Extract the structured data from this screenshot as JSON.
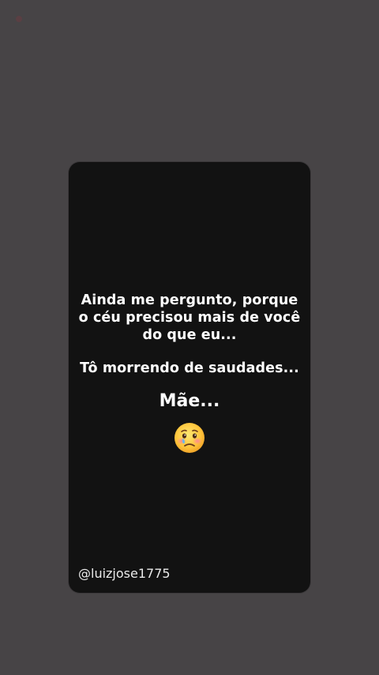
{
  "story": {
    "lines": [
      "Ainda me pergunto, porque",
      "o céu precisou  mais de você",
      "do que eu..."
    ],
    "line2": "Tô morrendo de saudades...",
    "mae": "Mãe...",
    "emoji": "face-holding-back-tears-icon",
    "handle": "@luizjose1775"
  },
  "colors": {
    "background": "#474446",
    "card": "#121212",
    "text": "#ffffff"
  }
}
